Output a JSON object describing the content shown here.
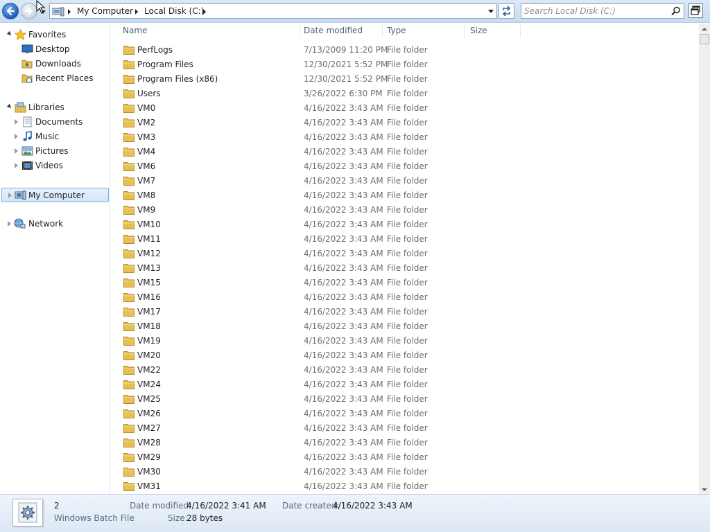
{
  "toolbar": {
    "breadcrumbs": [
      "My Computer",
      "Local Disk (C:)"
    ],
    "search_placeholder": "Search Local Disk (C:)"
  },
  "nav": {
    "favorites": {
      "label": "Favorites",
      "items": [
        "Desktop",
        "Downloads",
        "Recent Places"
      ]
    },
    "libraries": {
      "label": "Libraries",
      "items": [
        "Documents",
        "Music",
        "Pictures",
        "Videos"
      ]
    },
    "computer": "My Computer",
    "network": "Network"
  },
  "columns": {
    "name": "Name",
    "date": "Date modified",
    "type": "Type",
    "size": "Size"
  },
  "files": [
    {
      "name": "PerfLogs",
      "date": "7/13/2009 11:20 PM",
      "type": "File folder"
    },
    {
      "name": "Program Files",
      "date": "12/30/2021 5:52 PM",
      "type": "File folder"
    },
    {
      "name": "Program Files (x86)",
      "date": "12/30/2021 5:52 PM",
      "type": "File folder"
    },
    {
      "name": "Users",
      "date": "3/26/2022 6:30 PM",
      "type": "File folder"
    },
    {
      "name": "VM0",
      "date": "4/16/2022 3:43 AM",
      "type": "File folder"
    },
    {
      "name": "VM2",
      "date": "4/16/2022 3:43 AM",
      "type": "File folder"
    },
    {
      "name": "VM3",
      "date": "4/16/2022 3:43 AM",
      "type": "File folder"
    },
    {
      "name": "VM4",
      "date": "4/16/2022 3:43 AM",
      "type": "File folder"
    },
    {
      "name": "VM6",
      "date": "4/16/2022 3:43 AM",
      "type": "File folder"
    },
    {
      "name": "VM7",
      "date": "4/16/2022 3:43 AM",
      "type": "File folder"
    },
    {
      "name": "VM8",
      "date": "4/16/2022 3:43 AM",
      "type": "File folder"
    },
    {
      "name": "VM9",
      "date": "4/16/2022 3:43 AM",
      "type": "File folder"
    },
    {
      "name": "VM10",
      "date": "4/16/2022 3:43 AM",
      "type": "File folder"
    },
    {
      "name": "VM11",
      "date": "4/16/2022 3:43 AM",
      "type": "File folder"
    },
    {
      "name": "VM12",
      "date": "4/16/2022 3:43 AM",
      "type": "File folder"
    },
    {
      "name": "VM13",
      "date": "4/16/2022 3:43 AM",
      "type": "File folder"
    },
    {
      "name": "VM15",
      "date": "4/16/2022 3:43 AM",
      "type": "File folder"
    },
    {
      "name": "VM16",
      "date": "4/16/2022 3:43 AM",
      "type": "File folder"
    },
    {
      "name": "VM17",
      "date": "4/16/2022 3:43 AM",
      "type": "File folder"
    },
    {
      "name": "VM18",
      "date": "4/16/2022 3:43 AM",
      "type": "File folder"
    },
    {
      "name": "VM19",
      "date": "4/16/2022 3:43 AM",
      "type": "File folder"
    },
    {
      "name": "VM20",
      "date": "4/16/2022 3:43 AM",
      "type": "File folder"
    },
    {
      "name": "VM22",
      "date": "4/16/2022 3:43 AM",
      "type": "File folder"
    },
    {
      "name": "VM24",
      "date": "4/16/2022 3:43 AM",
      "type": "File folder"
    },
    {
      "name": "VM25",
      "date": "4/16/2022 3:43 AM",
      "type": "File folder"
    },
    {
      "name": "VM26",
      "date": "4/16/2022 3:43 AM",
      "type": "File folder"
    },
    {
      "name": "VM27",
      "date": "4/16/2022 3:43 AM",
      "type": "File folder"
    },
    {
      "name": "VM28",
      "date": "4/16/2022 3:43 AM",
      "type": "File folder"
    },
    {
      "name": "VM29",
      "date": "4/16/2022 3:43 AM",
      "type": "File folder"
    },
    {
      "name": "VM30",
      "date": "4/16/2022 3:43 AM",
      "type": "File folder"
    },
    {
      "name": "VM31",
      "date": "4/16/2022 3:43 AM",
      "type": "File folder"
    }
  ],
  "details": {
    "name": "2",
    "file_type": "Windows Batch File",
    "date_modified_label": "Date modified:",
    "date_modified": "4/16/2022 3:41 AM",
    "date_created_label": "Date created:",
    "date_created": "4/16/2022 3:43 AM",
    "size_label": "Size:",
    "size": "28 bytes"
  },
  "colors": {
    "selection": "#d3e6fa",
    "accent": "#1d5bb8",
    "folder": "#e8c050"
  }
}
